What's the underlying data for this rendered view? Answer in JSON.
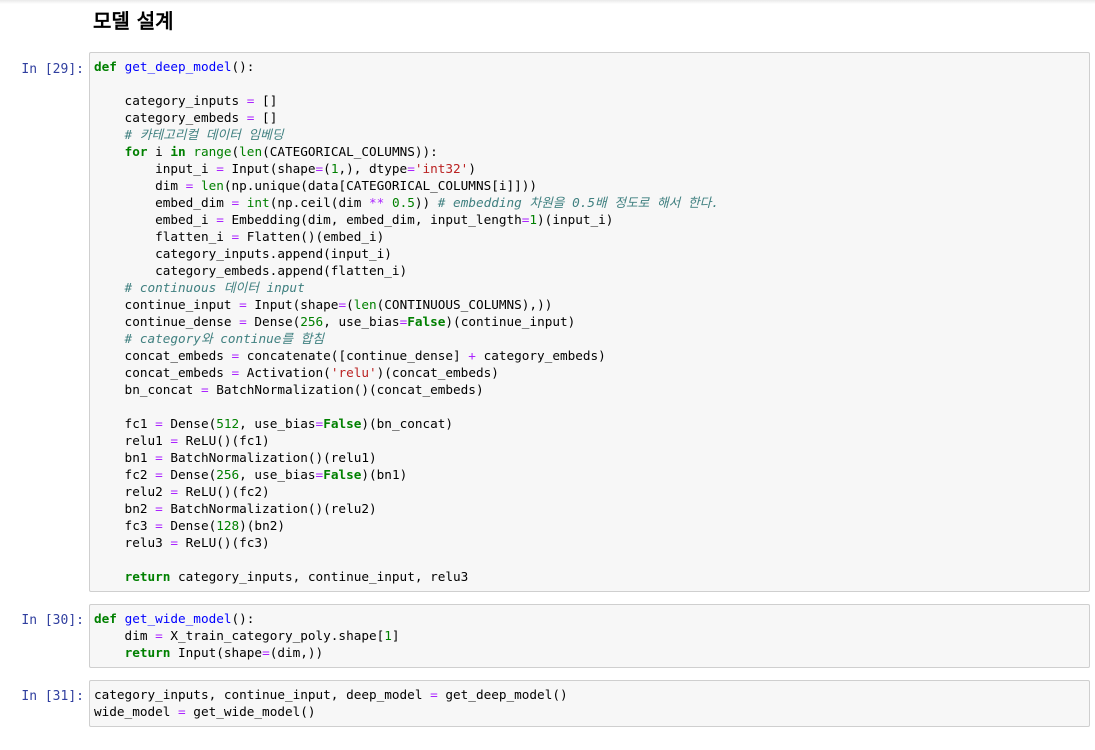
{
  "notebook": {
    "heading": "모델 설계",
    "cells": [
      {
        "prompt": "In [29]:",
        "lines": [
          [
            [
              "k",
              "def"
            ],
            [
              "",
              " "
            ],
            [
              "nf",
              "get_deep_model"
            ],
            [
              "",
              "():"
            ]
          ],
          [],
          [
            [
              "",
              "    category_inputs "
            ],
            [
              "o",
              "="
            ],
            [
              "",
              " []"
            ]
          ],
          [
            [
              "",
              "    category_embeds "
            ],
            [
              "o",
              "="
            ],
            [
              "",
              " []"
            ]
          ],
          [
            [
              "c",
              "    # 카테고리컬 데이터 임베딩"
            ]
          ],
          [
            [
              "",
              "    "
            ],
            [
              "k",
              "for"
            ],
            [
              "",
              " i "
            ],
            [
              "k",
              "in"
            ],
            [
              "",
              " "
            ],
            [
              "nb",
              "range"
            ],
            [
              "",
              "("
            ],
            [
              "nb",
              "len"
            ],
            [
              "",
              "(CATEGORICAL_COLUMNS)):"
            ]
          ],
          [
            [
              "",
              "        input_i "
            ],
            [
              "o",
              "="
            ],
            [
              "",
              " Input(shape"
            ],
            [
              "o",
              "="
            ],
            [
              "",
              "("
            ],
            [
              "mi",
              "1"
            ],
            [
              "",
              ",), dtype"
            ],
            [
              "o",
              "="
            ],
            [
              "s",
              "'int32'"
            ],
            [
              "",
              ")"
            ]
          ],
          [
            [
              "",
              "        dim "
            ],
            [
              "o",
              "="
            ],
            [
              "",
              " "
            ],
            [
              "nb",
              "len"
            ],
            [
              "",
              "(np.unique(data[CATEGORICAL_COLUMNS[i]]))"
            ]
          ],
          [
            [
              "",
              "        embed_dim "
            ],
            [
              "o",
              "="
            ],
            [
              "",
              " "
            ],
            [
              "nb",
              "int"
            ],
            [
              "",
              "(np.ceil(dim "
            ],
            [
              "o",
              "**"
            ],
            [
              "",
              " "
            ],
            [
              "mi",
              "0.5"
            ],
            [
              "",
              ")) "
            ],
            [
              "c",
              "# embedding 차원을 0.5배 정도로 해서 한다."
            ]
          ],
          [
            [
              "",
              "        embed_i "
            ],
            [
              "o",
              "="
            ],
            [
              "",
              " Embedding(dim, embed_dim, input_length"
            ],
            [
              "o",
              "="
            ],
            [
              "mi",
              "1"
            ],
            [
              "",
              ")(input_i)"
            ]
          ],
          [
            [
              "",
              "        flatten_i "
            ],
            [
              "o",
              "="
            ],
            [
              "",
              " Flatten()(embed_i)"
            ]
          ],
          [
            [
              "",
              "        category_inputs.append(input_i)"
            ]
          ],
          [
            [
              "",
              "        category_embeds.append(flatten_i)"
            ]
          ],
          [
            [
              "c",
              "    # continuous 데이터 input"
            ]
          ],
          [
            [
              "",
              "    continue_input "
            ],
            [
              "o",
              "="
            ],
            [
              "",
              " Input(shape"
            ],
            [
              "o",
              "="
            ],
            [
              "",
              "("
            ],
            [
              "nb",
              "len"
            ],
            [
              "",
              "(CONTINUOUS_COLUMNS),))"
            ]
          ],
          [
            [
              "",
              "    continue_dense "
            ],
            [
              "o",
              "="
            ],
            [
              "",
              " Dense("
            ],
            [
              "mi",
              "256"
            ],
            [
              "",
              ", use_bias"
            ],
            [
              "o",
              "="
            ],
            [
              "k",
              "False"
            ],
            [
              "",
              ")(continue_input)"
            ]
          ],
          [
            [
              "c",
              "    # category와 continue를 합침"
            ]
          ],
          [
            [
              "",
              "    concat_embeds "
            ],
            [
              "o",
              "="
            ],
            [
              "",
              " concatenate([continue_dense] "
            ],
            [
              "o",
              "+"
            ],
            [
              "",
              " category_embeds)"
            ]
          ],
          [
            [
              "",
              "    concat_embeds "
            ],
            [
              "o",
              "="
            ],
            [
              "",
              " Activation("
            ],
            [
              "s",
              "'relu'"
            ],
            [
              "",
              ")(concat_embeds)"
            ]
          ],
          [
            [
              "",
              "    bn_concat "
            ],
            [
              "o",
              "="
            ],
            [
              "",
              " BatchNormalization()(concat_embeds)"
            ]
          ],
          [],
          [
            [
              "",
              "    fc1 "
            ],
            [
              "o",
              "="
            ],
            [
              "",
              " Dense("
            ],
            [
              "mi",
              "512"
            ],
            [
              "",
              ", use_bias"
            ],
            [
              "o",
              "="
            ],
            [
              "k",
              "False"
            ],
            [
              "",
              ")(bn_concat)"
            ]
          ],
          [
            [
              "",
              "    relu1 "
            ],
            [
              "o",
              "="
            ],
            [
              "",
              " ReLU()(fc1)"
            ]
          ],
          [
            [
              "",
              "    bn1 "
            ],
            [
              "o",
              "="
            ],
            [
              "",
              " BatchNormalization()(relu1)"
            ]
          ],
          [
            [
              "",
              "    fc2 "
            ],
            [
              "o",
              "="
            ],
            [
              "",
              " Dense("
            ],
            [
              "mi",
              "256"
            ],
            [
              "",
              ", use_bias"
            ],
            [
              "o",
              "="
            ],
            [
              "k",
              "False"
            ],
            [
              "",
              ")(bn1)"
            ]
          ],
          [
            [
              "",
              "    relu2 "
            ],
            [
              "o",
              "="
            ],
            [
              "",
              " ReLU()(fc2)"
            ]
          ],
          [
            [
              "",
              "    bn2 "
            ],
            [
              "o",
              "="
            ],
            [
              "",
              " BatchNormalization()(relu2)"
            ]
          ],
          [
            [
              "",
              "    fc3 "
            ],
            [
              "o",
              "="
            ],
            [
              "",
              " Dense("
            ],
            [
              "mi",
              "128"
            ],
            [
              "",
              ")(bn2)"
            ]
          ],
          [
            [
              "",
              "    relu3 "
            ],
            [
              "o",
              "="
            ],
            [
              "",
              " ReLU()(fc3)"
            ]
          ],
          [],
          [
            [
              "",
              "    "
            ],
            [
              "k",
              "return"
            ],
            [
              "",
              " category_inputs, continue_input, relu3"
            ]
          ]
        ]
      },
      {
        "prompt": "In [30]:",
        "lines": [
          [
            [
              "k",
              "def"
            ],
            [
              "",
              " "
            ],
            [
              "nf",
              "get_wide_model"
            ],
            [
              "",
              "():"
            ]
          ],
          [
            [
              "",
              "    dim "
            ],
            [
              "o",
              "="
            ],
            [
              "",
              " X_train_category_poly.shape["
            ],
            [
              "mi",
              "1"
            ],
            [
              "",
              "]"
            ]
          ],
          [
            [
              "",
              "    "
            ],
            [
              "k",
              "return"
            ],
            [
              "",
              " Input(shape"
            ],
            [
              "o",
              "="
            ],
            [
              "",
              "(dim,))"
            ]
          ]
        ]
      },
      {
        "prompt": "In [31]:",
        "lines": [
          [
            [
              "",
              "category_inputs, continue_input, deep_model "
            ],
            [
              "o",
              "="
            ],
            [
              "",
              " get_deep_model()"
            ]
          ],
          [
            [
              "",
              "wide_model "
            ],
            [
              "o",
              "="
            ],
            [
              "",
              " get_wide_model()"
            ]
          ]
        ]
      }
    ]
  },
  "colors": {
    "prompt": "#303f9f",
    "keyword": "#008000",
    "function_name": "#0000ff",
    "operator": "#aa22ff",
    "string": "#ba2121",
    "comment": "#408080",
    "cell_background": "#f7f7f7",
    "cell_border": "#cfcfcf"
  }
}
